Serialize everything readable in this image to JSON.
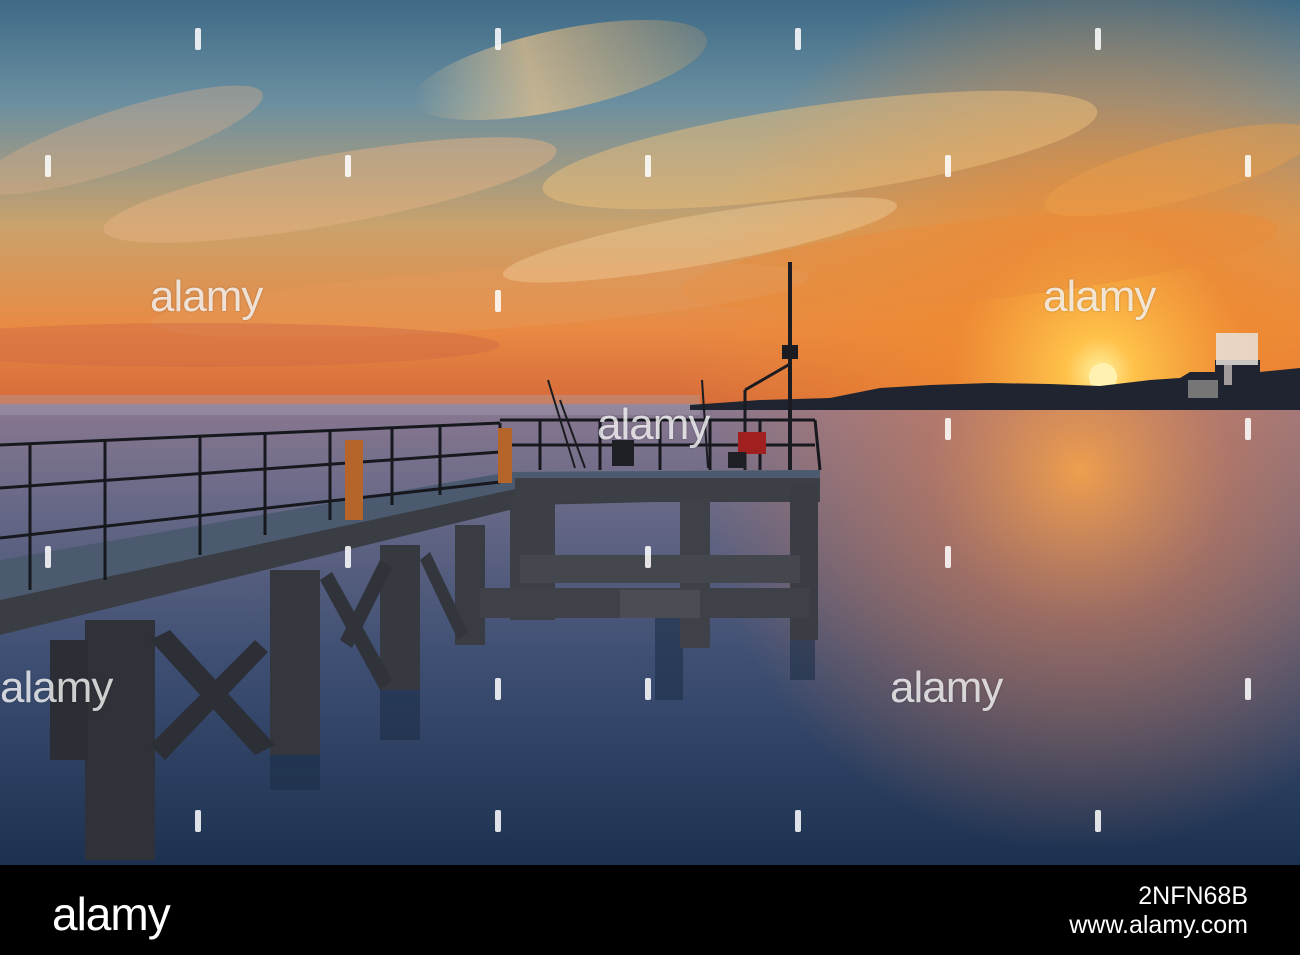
{
  "watermark": {
    "text": "alamy"
  },
  "footer": {
    "logo": "alamy",
    "image_id": "2NFN68B",
    "url": "www.alamy.com"
  },
  "colors": {
    "sky_top": "#3f6f88",
    "sun": "#ffb43a",
    "horizon": "#f07a2a",
    "water_deep": "#1d3550",
    "pier": "#2b2d33"
  }
}
